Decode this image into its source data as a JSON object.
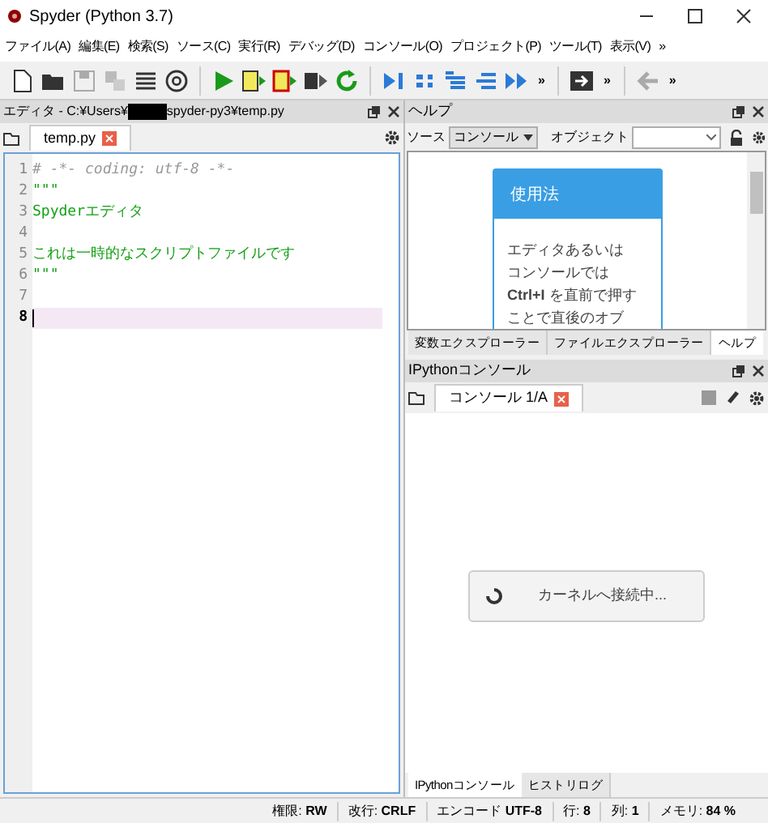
{
  "window": {
    "title": "Spyder (Python 3.7)"
  },
  "menu": [
    "ファイル(A)",
    "編集(E)",
    "検索(S)",
    "ソース(C)",
    "実行(R)",
    "デバッグ(D)",
    "コンソール(O)",
    "プロジェクト(P)",
    "ツール(T)",
    "表示(V)",
    "»"
  ],
  "toolbar": {
    "overflow": [
      "»",
      "»",
      "»"
    ]
  },
  "editor": {
    "title_start": "エディタ - C:¥Users¥",
    "title_end": "spyder-py3¥temp.py",
    "tab": "temp.py",
    "lines": [
      {
        "number": "1",
        "text": "# -*- coding: utf-8 -*-",
        "kind": "comment",
        "selected": false
      },
      {
        "number": "2",
        "text": "\"\"\"",
        "kind": "string",
        "selected": false
      },
      {
        "number": "3",
        "text": "Spyderエディタ",
        "kind": "string",
        "selected": false
      },
      {
        "number": "4",
        "kind": "blank",
        "selected": false
      },
      {
        "number": "5",
        "text": "これは一時的なスクリプトファイルです",
        "kind": "string",
        "selected": false
      },
      {
        "number": "6",
        "text": "\"\"\"",
        "kind": "string",
        "selected": false
      },
      {
        "number": "7",
        "kind": "blank",
        "selected": false
      },
      {
        "number": "8",
        "kind": "blank",
        "selected": true
      }
    ]
  },
  "help": {
    "title": "ヘルプ",
    "source_label": "ソース",
    "source_value": "コンソール",
    "object_label": "オブジェクト",
    "card_title": "使用法",
    "card_lines": [
      "エディタあるいは",
      "コンソールでは",
      "**Ctrl+I** を直前で押す",
      "ことで直後のオブ"
    ],
    "tabs": [
      {
        "label": "変数エクスプローラー",
        "selected": false
      },
      {
        "label": "ファイルエクスプローラー",
        "selected": false
      },
      {
        "label": "ヘルプ",
        "selected": true
      }
    ]
  },
  "console": {
    "title": "IPythonコンソール",
    "tab": "コンソール 1/A",
    "loading": "カーネルへ接続中...",
    "tabs": [
      {
        "label": "IPythonコンソール",
        "selected": true
      },
      {
        "label": "ヒストリログ",
        "selected": false
      }
    ]
  },
  "status_bar": [
    {
      "label": "権限:",
      "value": "RW"
    },
    {
      "label": "改行:",
      "value": "CRLF"
    },
    {
      "label": "エンコード",
      "value": "UTF-8"
    },
    {
      "label": "行:",
      "value": "8"
    },
    {
      "label": "列:",
      "value": "1"
    },
    {
      "label": "メモリ:",
      "value": "84 %"
    }
  ]
}
